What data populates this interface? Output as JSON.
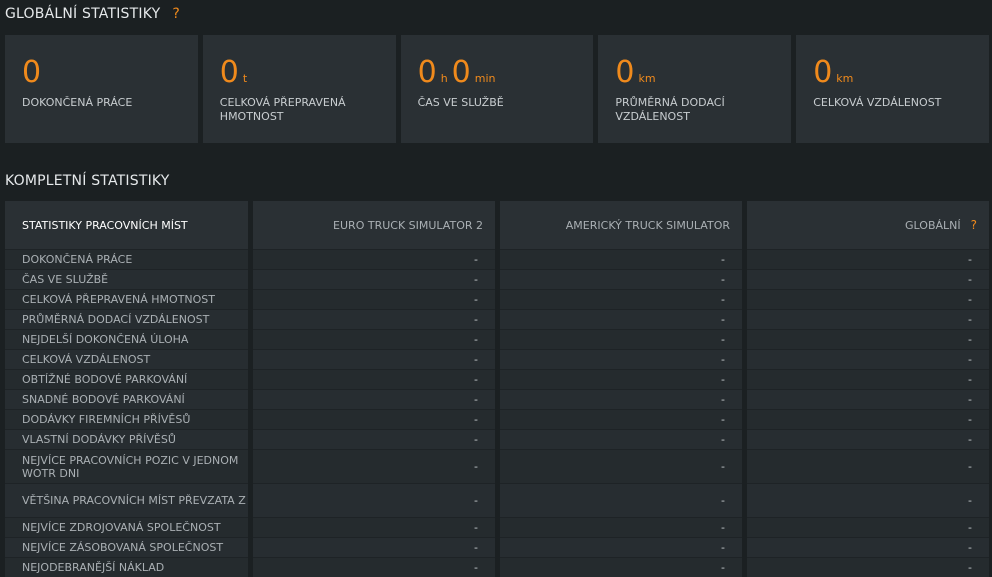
{
  "global": {
    "title": "GLOBÁLNÍ STATISTIKY",
    "help": "?",
    "cards": [
      {
        "parts": [
          {
            "num": "0",
            "unit": ""
          }
        ],
        "label": "DOKONČENÁ PRÁCE"
      },
      {
        "parts": [
          {
            "num": "0",
            "unit": "t"
          }
        ],
        "label": "CELKOVÁ PŘEPRAVENÁ HMOTNOST"
      },
      {
        "parts": [
          {
            "num": "0",
            "unit": "h"
          },
          {
            "num": "0",
            "unit": "min"
          }
        ],
        "label": "ČAS VE SLUŽBĚ"
      },
      {
        "parts": [
          {
            "num": "0",
            "unit": "km"
          }
        ],
        "label": "PRŮMĚRNÁ DODACÍ VZDÁLENOST"
      },
      {
        "parts": [
          {
            "num": "0",
            "unit": "km"
          }
        ],
        "label": "CELKOVÁ VZDÁLENOST"
      }
    ]
  },
  "complete": {
    "title": "KOMPLETNÍ STATISTIKY",
    "headers": [
      "STATISTIKY PRACOVNÍCH MÍST",
      "EURO TRUCK SIMULATOR 2",
      "AMERICKÝ TRUCK SIMULATOR",
      "GLOBÁLNÍ"
    ],
    "global_help": "?",
    "rows": [
      {
        "label": "DOKONČENÁ PRÁCE",
        "values": [
          "-",
          "-",
          "-"
        ]
      },
      {
        "label": "ČAS VE SLUŽBĚ",
        "values": [
          "-",
          "-",
          "-"
        ]
      },
      {
        "label": "CELKOVÁ PŘEPRAVENÁ HMOTNOST",
        "values": [
          "-",
          "-",
          "-"
        ]
      },
      {
        "label": "PRŮMĚRNÁ DODACÍ VZDÁLENOST",
        "values": [
          "-",
          "-",
          "-"
        ]
      },
      {
        "label": "NEJDELŠÍ DOKONČENÁ ÚLOHA",
        "values": [
          "-",
          "-",
          "-"
        ]
      },
      {
        "label": "CELKOVÁ VZDÁLENOST",
        "values": [
          "-",
          "-",
          "-"
        ]
      },
      {
        "label": "OBTÍŽNÉ BODOVÉ PARKOVÁNÍ",
        "values": [
          "-",
          "-",
          "-"
        ]
      },
      {
        "label": "SNADNÉ BODOVÉ PARKOVÁNÍ",
        "values": [
          "-",
          "-",
          "-"
        ]
      },
      {
        "label": "DODÁVKY FIREMNÍCH PŘÍVĚSŮ",
        "values": [
          "-",
          "-",
          "-"
        ]
      },
      {
        "label": "VLASTNÍ DODÁVKY PŘÍVĚSŮ",
        "values": [
          "-",
          "-",
          "-"
        ]
      },
      {
        "label": "NEJVÍCE PRACOVNÍCH POZIC V JEDNOM WOTR DNI",
        "values": [
          "-",
          "-",
          "-"
        ]
      },
      {
        "label": "VĚTŠINA PRACOVNÍCH MÍST PŘEVZATA Z",
        "values": [
          "-",
          "-",
          "-"
        ]
      },
      {
        "label": "NEJVÍCE ZDROJOVANÁ SPOLEČNOST",
        "values": [
          "-",
          "-",
          "-"
        ]
      },
      {
        "label": "NEJVÍCE ZÁSOBOVANÁ SPOLEČNOST",
        "values": [
          "-",
          "-",
          "-"
        ]
      },
      {
        "label": "NEJODEBRANĚJŠÍ NÁKLAD",
        "values": [
          "-",
          "-",
          "-"
        ]
      }
    ]
  },
  "colors": {
    "accent": "#f08a1c",
    "card_bg": "#2a3034",
    "page_bg": "#1b2022"
  }
}
